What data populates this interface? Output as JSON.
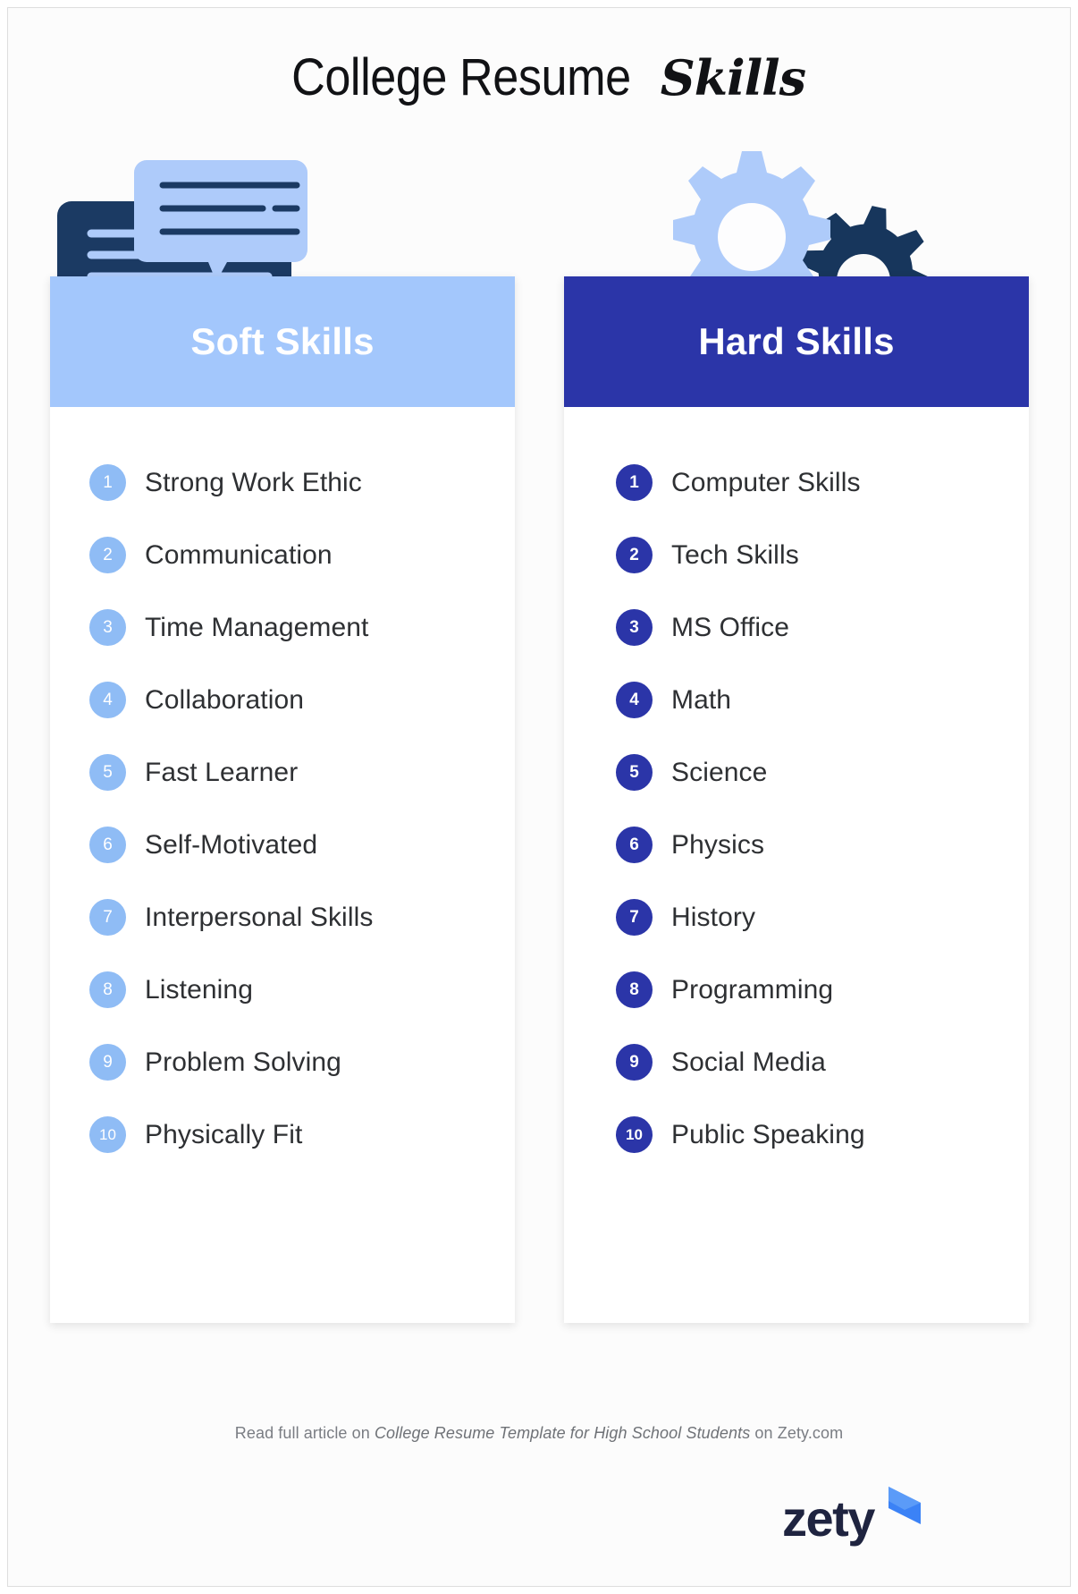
{
  "title": {
    "main": "College Resume",
    "accent": "Skills"
  },
  "colors": {
    "soft_header_bg": "#A3C7FC",
    "soft_badge_bg": "#8FBCF5",
    "hard_header_bg": "#2B35A8",
    "hard_badge_bg": "#2B35A8",
    "art_dark_navy": "#1B3A63",
    "art_light_blue": "#AECBFA",
    "page_bg": "#FCFCFC",
    "text": "#2E3033",
    "footer_text": "#7A7D83",
    "logo_navy": "#1F2440",
    "logo_blue": "#3B82F6"
  },
  "columns": {
    "soft": {
      "art_icon": "speech-bubbles-icon",
      "heading": "Soft Skills",
      "items": [
        {
          "num": "1",
          "label": "Strong Work Ethic"
        },
        {
          "num": "2",
          "label": "Communication"
        },
        {
          "num": "3",
          "label": "Time Management"
        },
        {
          "num": "4",
          "label": "Collaboration"
        },
        {
          "num": "5",
          "label": "Fast Learner"
        },
        {
          "num": "6",
          "label": "Self-Motivated"
        },
        {
          "num": "7",
          "label": "Interpersonal Skills"
        },
        {
          "num": "8",
          "label": "Listening"
        },
        {
          "num": "9",
          "label": "Problem Solving"
        },
        {
          "num": "10",
          "label": "Physically Fit"
        }
      ]
    },
    "hard": {
      "art_icon": "gears-icon",
      "heading": "Hard Skills",
      "items": [
        {
          "num": "1",
          "label": "Computer Skills"
        },
        {
          "num": "2",
          "label": "Tech Skills"
        },
        {
          "num": "3",
          "label": "MS Office"
        },
        {
          "num": "4",
          "label": "Math"
        },
        {
          "num": "5",
          "label": "Science"
        },
        {
          "num": "6",
          "label": "Physics"
        },
        {
          "num": "7",
          "label": "History"
        },
        {
          "num": "8",
          "label": "Programming"
        },
        {
          "num": "9",
          "label": "Social Media"
        },
        {
          "num": "10",
          "label": "Public Speaking"
        }
      ]
    }
  },
  "footer": {
    "prefix": "Read full article on ",
    "article": "College Resume Template for High School Students",
    "suffix": " on Zety.com",
    "logo_word": "zety",
    "logo_mark": "arrow-mark-icon"
  }
}
